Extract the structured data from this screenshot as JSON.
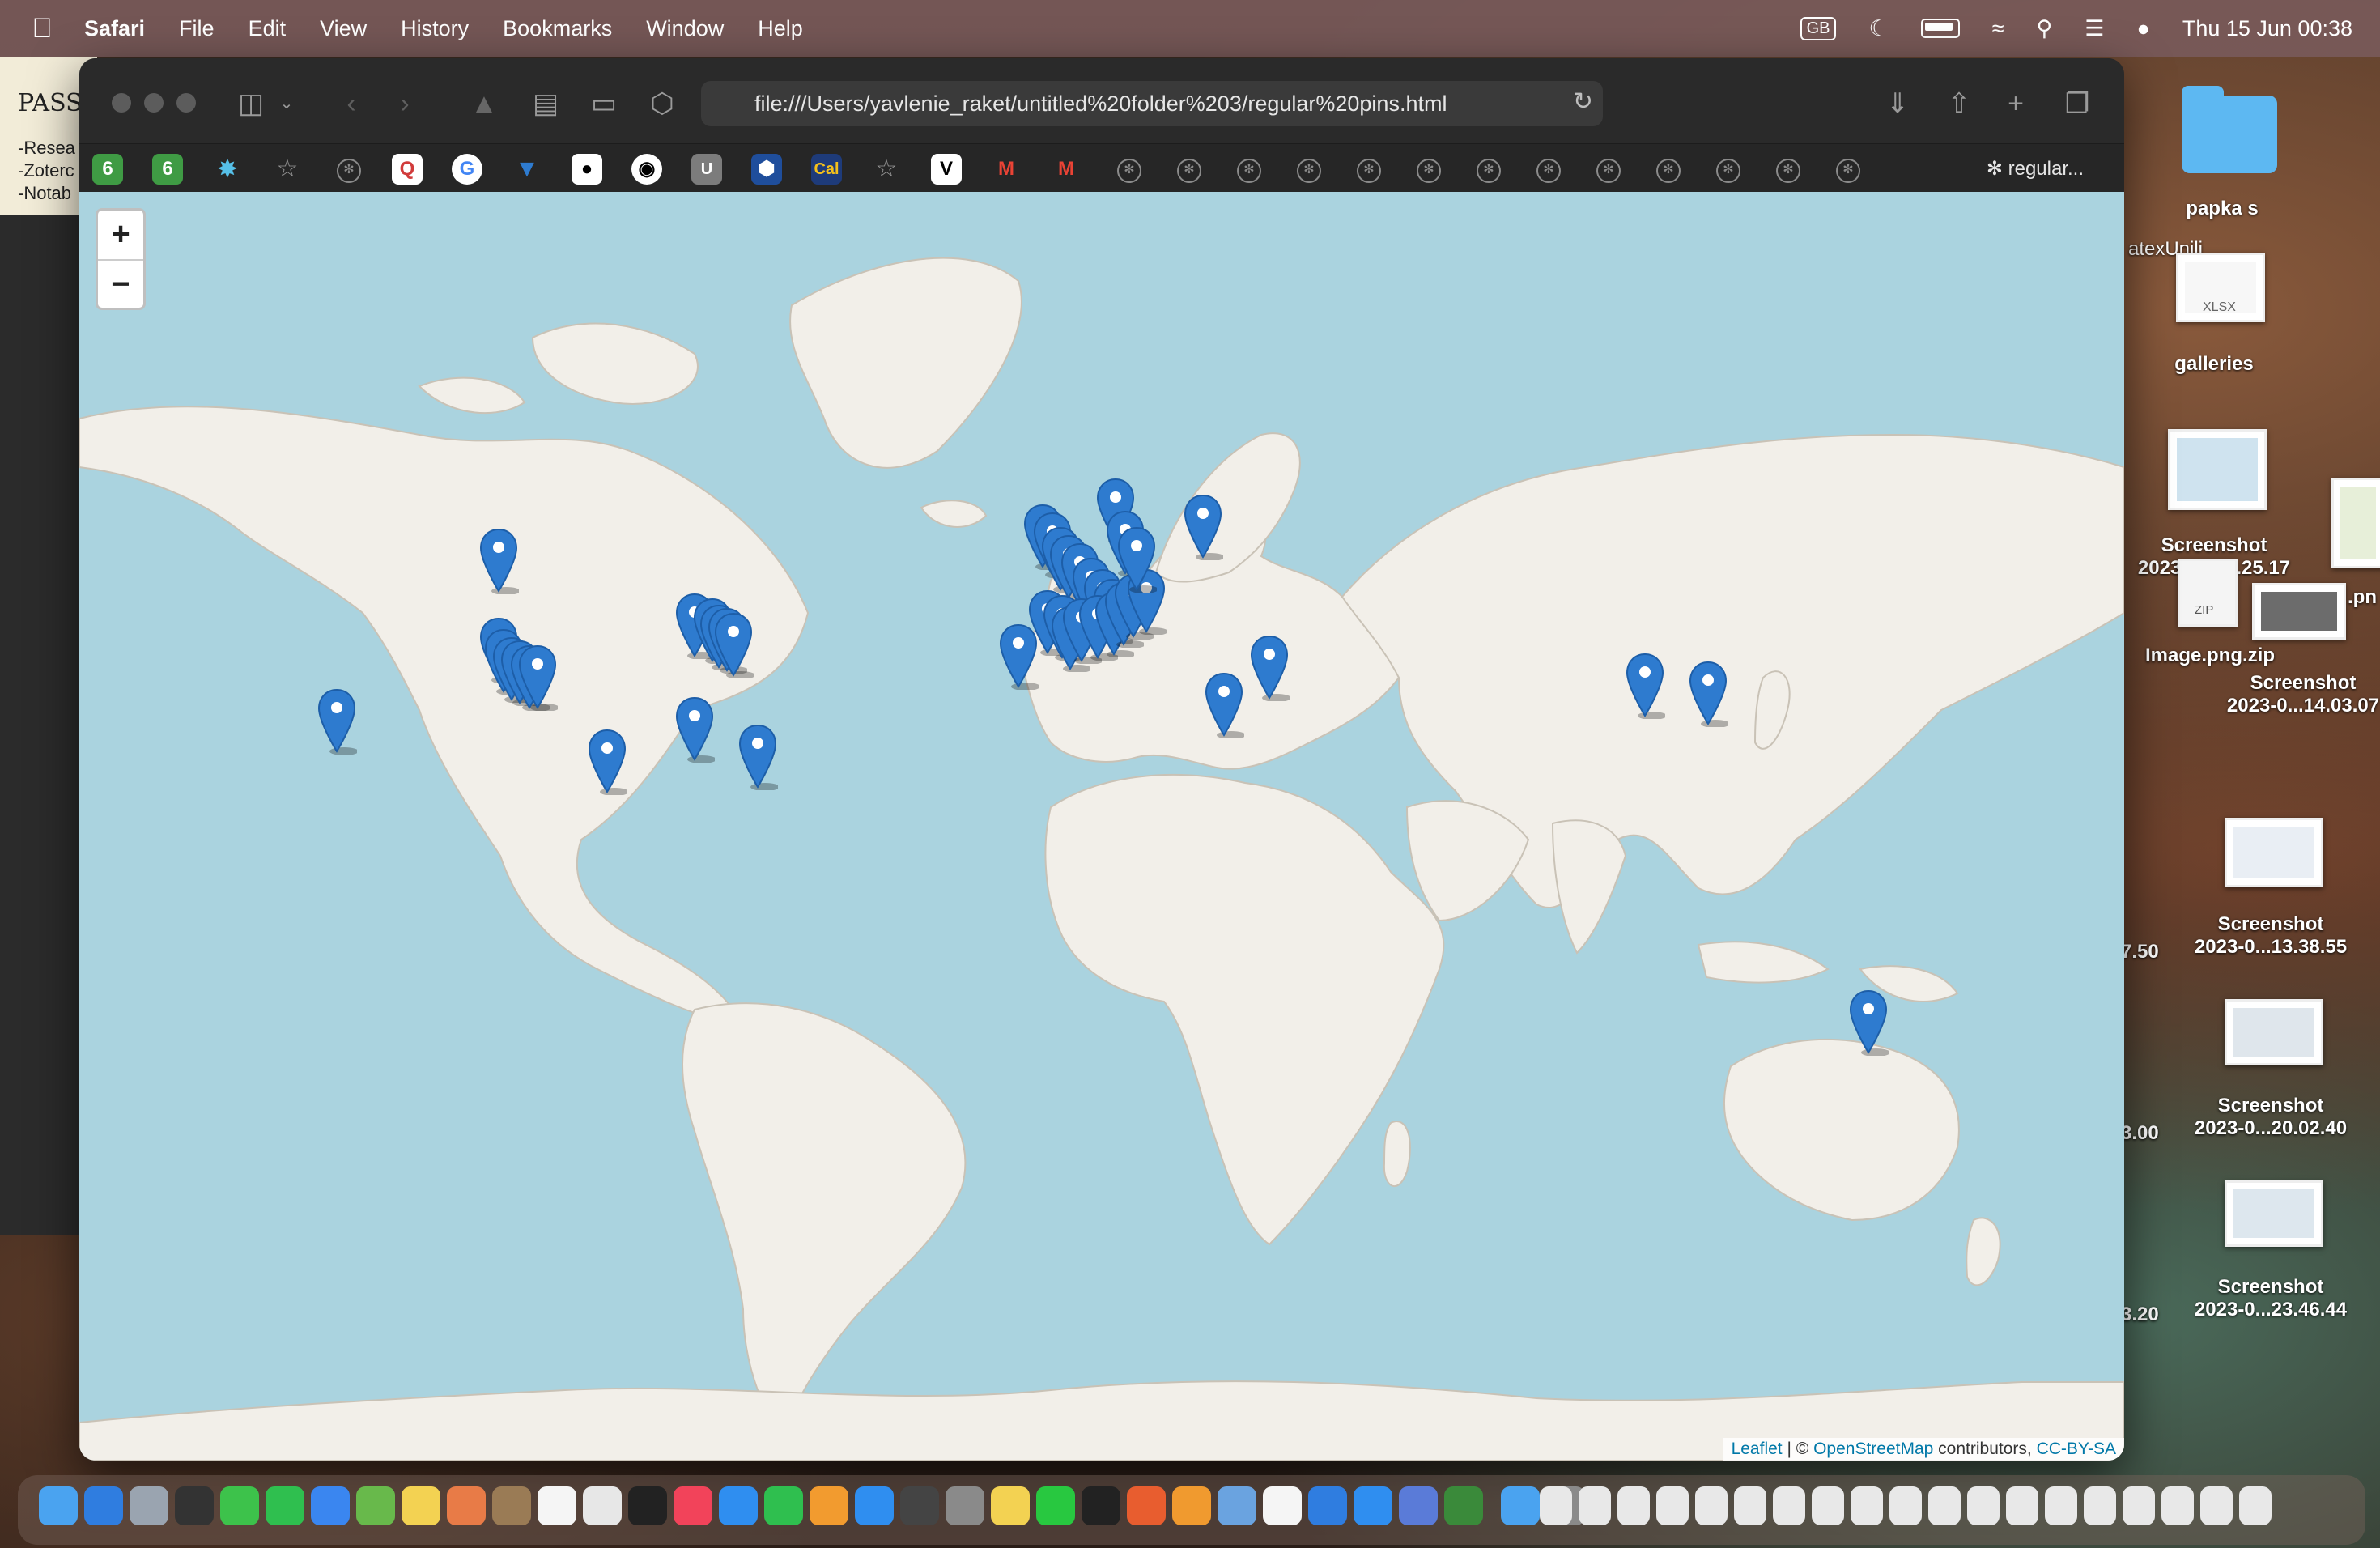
{
  "menubar": {
    "app_name": "Safari",
    "menus": [
      "File",
      "Edit",
      "View",
      "History",
      "Bookmarks",
      "Window",
      "Help"
    ],
    "keyboard": "GB",
    "clock": "Thu 15 Jun  00:38"
  },
  "background_app": {
    "title": "PASS",
    "lines": [
      "-Resea",
      "-Zoterc",
      "-Notab"
    ]
  },
  "desktop": {
    "items": [
      {
        "label": "papka s"
      },
      {
        "label": "atexUnili"
      },
      {
        "label": "galleries"
      },
      {
        "label": "Screenshot\n2023-0...13.25.17"
      },
      {
        "label": "Image.png.zip"
      },
      {
        "label": "Screenshot\n2023-0...14.03.07"
      },
      {
        "label": "Screenshot\n2023-0...13.38.55"
      },
      {
        "label": "Screenshot\n2023-0...20.02.40"
      },
      {
        "label": "Screenshot\n2023-0...23.46.44"
      }
    ],
    "partial_labels": [
      ".pn",
      "7.50",
      "3.00",
      "3.20"
    ],
    "zip_badge": "ZIP",
    "xlsx_badge": "XLSX"
  },
  "safari": {
    "url": "file:///Users/yavlenie_raket/untitled%20folder%203/regular%20pins.html",
    "tab_label": "regular...",
    "map": {
      "zoom_in": "+",
      "zoom_out": "−",
      "attribution": {
        "leaflet": "Leaflet",
        "sep": " | © ",
        "osm": "OpenStreetMap",
        "contributors": " contributors, ",
        "license": "CC-BY-SA"
      },
      "marker_count": 43
    }
  },
  "colors": {
    "ocean": "#aad3df",
    "land": "#f2efe9",
    "marker": "#2e7bcf"
  }
}
